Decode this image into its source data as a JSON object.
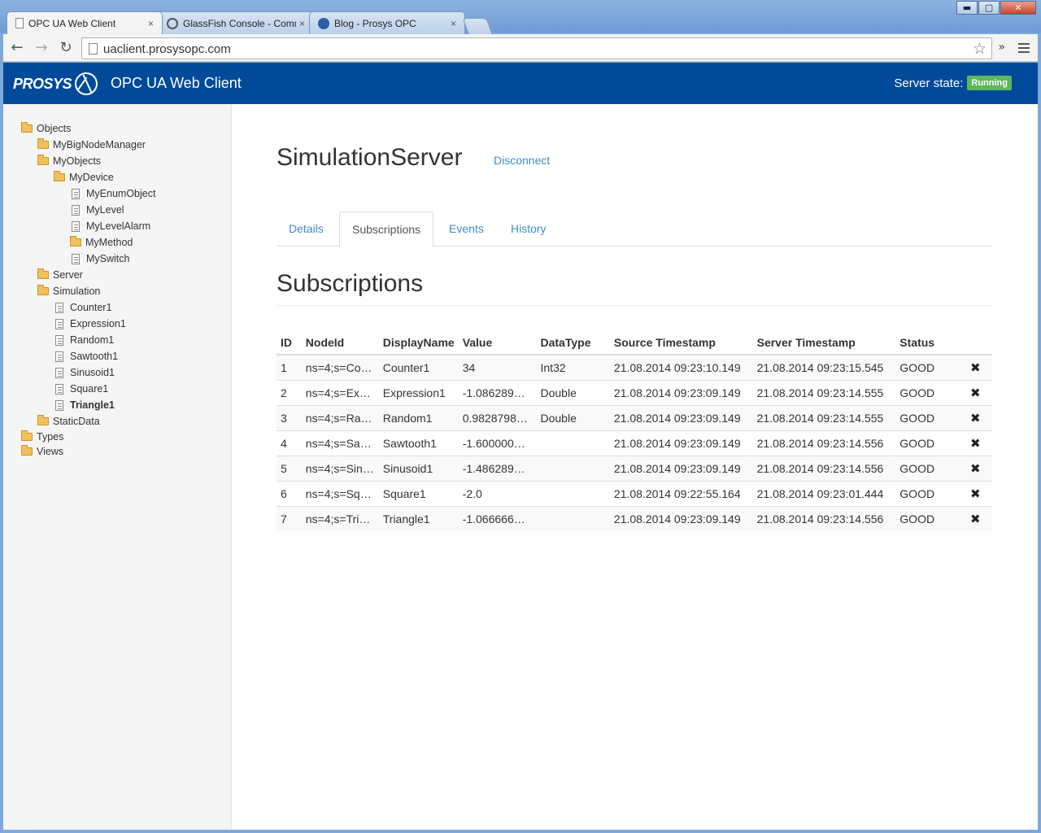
{
  "browser": {
    "tabs": [
      {
        "label": "OPC UA Web Client",
        "close": "×"
      },
      {
        "label": "GlassFish Console - Comm",
        "close": "×"
      },
      {
        "label": "Blog - Prosys OPC",
        "close": "×"
      }
    ],
    "url": "uaclient.prosysopc.com",
    "window_buttons": {
      "minimize": "▬",
      "maximize": "▢",
      "close": "✕"
    },
    "nav": {
      "back": "←",
      "forward": "→",
      "reload": "↻",
      "star": "☆",
      "extensions": "»"
    }
  },
  "header": {
    "logo_text": "PROSYS",
    "title": "OPC UA Web Client",
    "server_state_label": "Server state:",
    "server_state_value": "Running"
  },
  "tree": [
    {
      "label": "Objects",
      "type": "folder-open",
      "depth": 0
    },
    {
      "label": "MyBigNodeManager",
      "type": "folder",
      "depth": 1
    },
    {
      "label": "MyObjects",
      "type": "folder-open",
      "depth": 1
    },
    {
      "label": "MyDevice",
      "type": "folder-open",
      "depth": 2
    },
    {
      "label": "MyEnumObject",
      "type": "doc",
      "depth": 3
    },
    {
      "label": "MyLevel",
      "type": "doc",
      "depth": 3
    },
    {
      "label": "MyLevelAlarm",
      "type": "doc",
      "depth": 3
    },
    {
      "label": "MyMethod",
      "type": "folder",
      "depth": 3
    },
    {
      "label": "MySwitch",
      "type": "doc",
      "depth": 3
    },
    {
      "label": "Server",
      "type": "folder",
      "depth": 1
    },
    {
      "label": "Simulation",
      "type": "folder-open",
      "depth": 1
    },
    {
      "label": "Counter1",
      "type": "doc",
      "depth": 2
    },
    {
      "label": "Expression1",
      "type": "doc",
      "depth": 2
    },
    {
      "label": "Random1",
      "type": "doc",
      "depth": 2
    },
    {
      "label": "Sawtooth1",
      "type": "doc",
      "depth": 2
    },
    {
      "label": "Sinusoid1",
      "type": "doc",
      "depth": 2
    },
    {
      "label": "Square1",
      "type": "doc",
      "depth": 2
    },
    {
      "label": "Triangle1",
      "type": "doc",
      "depth": 2,
      "selected": true
    },
    {
      "label": "StaticData",
      "type": "folder",
      "depth": 1
    },
    {
      "label": "Types",
      "type": "folder",
      "depth": 0
    },
    {
      "label": "Views",
      "type": "folder",
      "depth": 0
    }
  ],
  "main": {
    "server_name": "SimulationServer",
    "disconnect_label": "Disconnect",
    "tabs": [
      {
        "label": "Details",
        "active": false
      },
      {
        "label": "Subscriptions",
        "active": true
      },
      {
        "label": "Events",
        "active": false
      },
      {
        "label": "History",
        "active": false
      }
    ],
    "section_title": "Subscriptions"
  },
  "table": {
    "columns": [
      "ID",
      "NodeId",
      "DisplayName",
      "Value",
      "DataType",
      "Source Timestamp",
      "Server Timestamp",
      "Status"
    ],
    "remove_icon": "✖",
    "rows": [
      [
        "1",
        "ns=4;s=Co…",
        "Counter1",
        "34",
        "Int32",
        "21.08.2014 09:23:10.149",
        "21.08.2014 09:23:15.545",
        "GOOD"
      ],
      [
        "2",
        "ns=4;s=Ex…",
        "Expression1",
        "-1.086289…",
        "Double",
        "21.08.2014 09:23:09.149",
        "21.08.2014 09:23:14.555",
        "GOOD"
      ],
      [
        "3",
        "ns=4;s=Ra…",
        "Random1",
        "0.9828798…",
        "Double",
        "21.08.2014 09:23:09.149",
        "21.08.2014 09:23:14.555",
        "GOOD"
      ],
      [
        "4",
        "ns=4;s=Sa…",
        "Sawtooth1",
        "-1.600000…",
        "",
        "21.08.2014 09:23:09.149",
        "21.08.2014 09:23:14.556",
        "GOOD"
      ],
      [
        "5",
        "ns=4;s=Sin…",
        "Sinusoid1",
        "-1.486289…",
        "",
        "21.08.2014 09:23:09.149",
        "21.08.2014 09:23:14.556",
        "GOOD"
      ],
      [
        "6",
        "ns=4;s=Sq…",
        "Square1",
        "-2.0",
        "",
        "21.08.2014 09:22:55.164",
        "21.08.2014 09:23:01.444",
        "GOOD"
      ],
      [
        "7",
        "ns=4;s=Tri…",
        "Triangle1",
        "-1.066666…",
        "",
        "21.08.2014 09:23:09.149",
        "21.08.2014 09:23:14.556",
        "GOOD"
      ]
    ]
  }
}
